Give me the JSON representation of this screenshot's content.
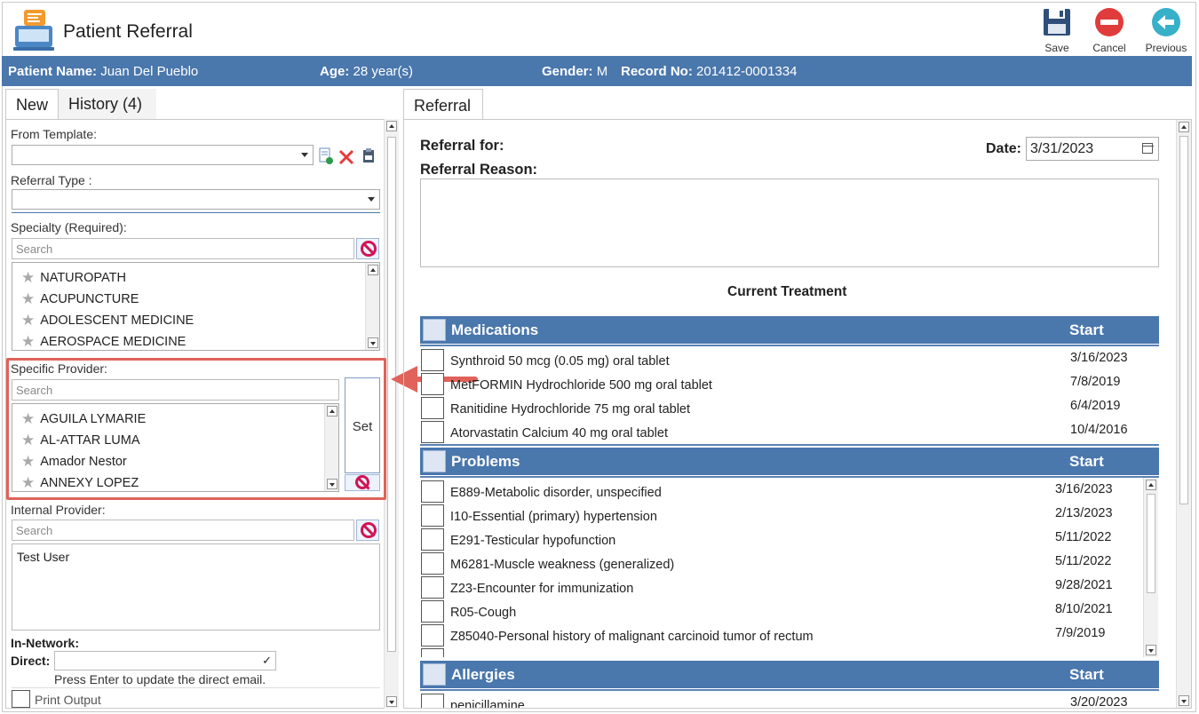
{
  "window": {
    "title": "Patient Referral",
    "toolbar": {
      "save": "Save",
      "cancel": "Cancel",
      "previous": "Previous"
    }
  },
  "patient": {
    "name_label": "Patient Name:",
    "name": "Juan Del Pueblo",
    "age_label": "Age:",
    "age": "28 year(s)",
    "gender_label": "Gender:",
    "gender": "M",
    "record_label": "Record No:",
    "record": "201412-0001334"
  },
  "left": {
    "tabs": {
      "new": "New",
      "history": "History",
      "history_count": "(4)"
    },
    "from_template_label": "From Template:",
    "referral_type_label": "Referral Type :",
    "specialty_label": "Specialty (Required):",
    "specialty_search_placeholder": "Search",
    "specialties": [
      "NATUROPATH",
      "ACUPUNCTURE",
      "ADOLESCENT MEDICINE",
      "AEROSPACE MEDICINE"
    ],
    "specific_provider_label": "Specific Provider:",
    "provider_search_placeholder": "Search",
    "providers": [
      "AGUILA LYMARIE",
      "AL-ATTAR LUMA",
      "Amador Nestor",
      "ANNEXY LOPEZ"
    ],
    "set_label": "Set",
    "internal_provider_label": "Internal Provider:",
    "internal_search_placeholder": "Search",
    "internal_provider_value": "Test User",
    "in_network_label": "In-Network:",
    "direct_label": "Direct:",
    "direct_hint": "Press Enter to update the direct email.",
    "print_output_label": "Print Output"
  },
  "right": {
    "tab": "Referral",
    "referral_for_label": "Referral for:",
    "referral_reason_label": "Referral Reason:",
    "date_label": "Date:",
    "date_value": "3/31/2023",
    "current_treatment": "Current Treatment",
    "start_label": "Start",
    "medications_title": "Medications",
    "medications": [
      {
        "name": "Synthroid 50 mcg (0.05 mg) oral tablet",
        "start": "3/16/2023"
      },
      {
        "name": "MetFORMIN Hydrochloride 500 mg oral tablet",
        "start": "7/8/2019"
      },
      {
        "name": "Ranitidine Hydrochloride 75 mg oral tablet",
        "start": "6/4/2019"
      },
      {
        "name": "Atorvastatin Calcium 40 mg oral tablet",
        "start": "10/4/2016"
      }
    ],
    "problems_title": "Problems",
    "problems": [
      {
        "name": "E889-Metabolic disorder, unspecified",
        "start": "3/16/2023"
      },
      {
        "name": "I10-Essential (primary) hypertension",
        "start": "2/13/2023"
      },
      {
        "name": "E291-Testicular hypofunction",
        "start": "5/11/2022"
      },
      {
        "name": "M6281-Muscle weakness (generalized)",
        "start": "5/11/2022"
      },
      {
        "name": "Z23-Encounter for immunization",
        "start": "9/28/2021"
      },
      {
        "name": "R05-Cough",
        "start": "8/10/2021"
      },
      {
        "name": "Z85040-Personal history of malignant carcinoid tumor of rectum",
        "start": "7/9/2019"
      }
    ],
    "allergies_title": "Allergies",
    "allergies": [
      {
        "name": "penicillamine",
        "start": "3/20/2023"
      }
    ]
  }
}
